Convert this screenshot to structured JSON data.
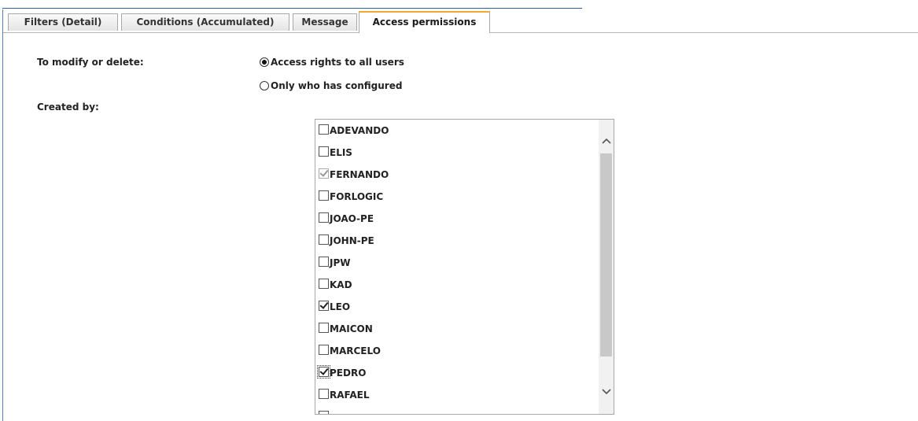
{
  "tabs": [
    {
      "label": "Filters (Detail)",
      "active": false
    },
    {
      "label": "Conditions (Accumulated)",
      "active": false
    },
    {
      "label": "Message",
      "active": false
    },
    {
      "label": "Access permissions",
      "active": true
    }
  ],
  "form": {
    "modify_label": "To modify or delete:",
    "created_by_label": "Created by:",
    "radio_options": [
      {
        "label": "Access rights to all users",
        "selected": true
      },
      {
        "label": "Only who has configured",
        "selected": false
      }
    ]
  },
  "users": [
    {
      "name": "ADEVANDO",
      "checked": false
    },
    {
      "name": "ELIS",
      "checked": false
    },
    {
      "name": "FERNANDO",
      "checked": true,
      "disabled": true
    },
    {
      "name": "FORLOGIC",
      "checked": false
    },
    {
      "name": "JOAO-PE",
      "checked": false
    },
    {
      "name": "JOHN-PE",
      "checked": false
    },
    {
      "name": "JPW",
      "checked": false
    },
    {
      "name": "KAD",
      "checked": false
    },
    {
      "name": "LEO",
      "checked": true
    },
    {
      "name": "MAICON",
      "checked": false
    },
    {
      "name": "MARCELO",
      "checked": false
    },
    {
      "name": "PEDRO",
      "checked": true,
      "focused": true
    },
    {
      "name": "RAFAEL",
      "checked": false
    },
    {
      "name": "",
      "checked": false
    }
  ],
  "icons": {
    "scroll_up": "chevron-up-icon",
    "scroll_down": "chevron-down-icon"
  },
  "colors": {
    "active_tab_accent": "#f0a830",
    "frame_line": "#2b5fa8"
  }
}
